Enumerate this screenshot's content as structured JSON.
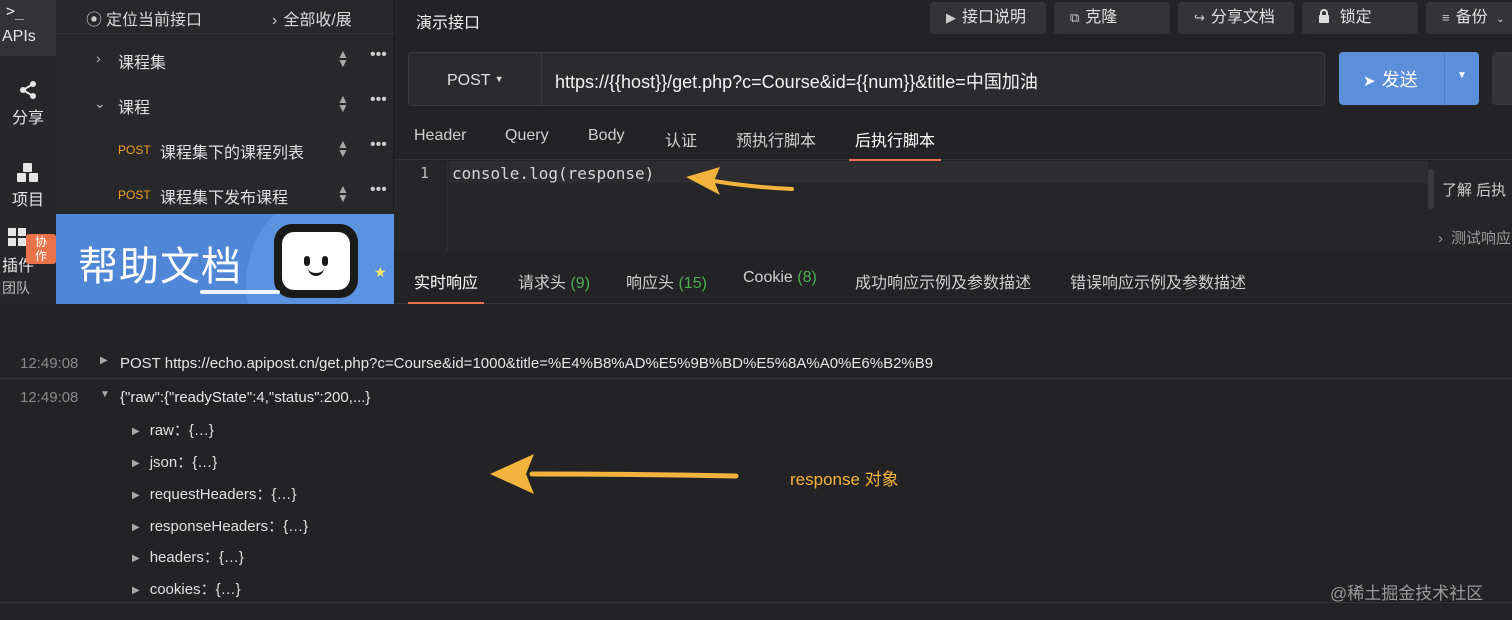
{
  "rail": {
    "apis_icon": ">_",
    "apis_label": "APIs",
    "share_label": "分享",
    "projects_label": "项目",
    "plugins_label": "插件",
    "plugins_badge": "协作",
    "team_label": "团队"
  },
  "tree": {
    "locate_label": "定位当前接口",
    "expand_label": "全部收/展",
    "items": [
      {
        "name": "课程集",
        "expanded": false
      },
      {
        "name": "课程",
        "expanded": true
      },
      {
        "method": "POST",
        "name": "课程集下的课程列表"
      },
      {
        "method": "POST",
        "name": "课程集下发布课程"
      }
    ],
    "more_icon": "•••"
  },
  "help_banner": {
    "title": "帮助文档"
  },
  "header": {
    "api_title": "演示接口",
    "buttons": {
      "doc": "接口说明",
      "clone": "克隆",
      "share": "分享文档",
      "lock": "锁定",
      "backup": "备份"
    }
  },
  "request": {
    "method": "POST",
    "url": "https://{{host}}/get.php?c=Course&id={{num}}&title=中国加油",
    "send_label": "发送"
  },
  "request_tabs": [
    "Header",
    "Query",
    "Body",
    "认证",
    "预执行脚本",
    "后执行脚本"
  ],
  "request_tabs_active": 5,
  "editor": {
    "line_number": "1",
    "code": "console.log(response)"
  },
  "editor_side": {
    "help_link": "了解 后执",
    "test_link": "测试响应"
  },
  "response_tabs": [
    {
      "label": "实时响应",
      "count": ""
    },
    {
      "label": "请求头",
      "count": "(9)"
    },
    {
      "label": "响应头",
      "count": "(15)"
    },
    {
      "label": "Cookie",
      "count": "(8)"
    },
    {
      "label": "成功响应示例及参数描述",
      "count": ""
    },
    {
      "label": "错误响应示例及参数描述",
      "count": ""
    }
  ],
  "response_tabs_active": 0,
  "console": {
    "entries": [
      {
        "time": "12:49:08",
        "text": "POST  https://echo.apipost.cn/get.php?c=Course&id=1000&title=%E4%B8%AD%E5%9B%BD%E5%8A%A0%E6%B2%B9"
      },
      {
        "time": "12:49:08",
        "text": "{\"raw\":{\"readyState\":4,\"status\":200,...}"
      }
    ],
    "properties": [
      "raw：{…}",
      "json：{…}",
      "requestHeaders：{…}",
      "responseHeaders：{…}",
      "headers：{…}",
      "cookies：{…}"
    ]
  },
  "annotation": {
    "label": "response 对象",
    "color": "#f2b43c"
  },
  "watermark": "@稀土掘金技术社区",
  "colors": {
    "accent": "#e8734a",
    "send_button": "#5b8fd9",
    "method_post": "#f0a020",
    "count_green": "#4caf50"
  }
}
